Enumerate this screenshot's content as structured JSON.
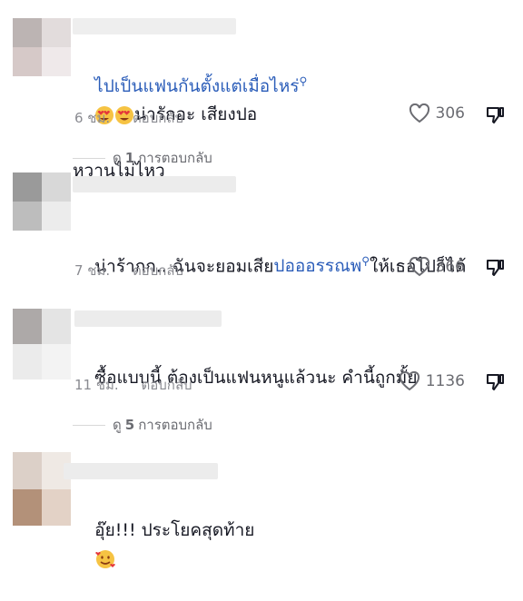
{
  "comments": [
    {
      "text_link": "ไปเป็นแฟนกันตั้งแต่เมื่อไหร่",
      "text_after": "น่ารักอะ เสียงปอ",
      "text_line2": "หวานไม่ไหว",
      "time": "6 ชม.",
      "reply_label": "ตอบกลับ",
      "likes": "306",
      "view_replies_prefix": "ดู",
      "view_replies_count": "1",
      "view_replies_suffix": "การตอบกลับ"
    },
    {
      "text_before": "น่าร้ากก.. ฉันจะยอมเสีย",
      "text_link": "ปอออรรณพ",
      "text_after": "ให้เธอไปก็ได้",
      "time": "7 ชม.",
      "reply_label": "ตอบกลับ",
      "likes": "366"
    },
    {
      "text": "ซื้อแบบนี้ ต้องเป็นแฟนหนูแล้วนะ คำนี้ถูกมั้ย",
      "time": "11 ชม.",
      "reply_label": "ตอบกลับ",
      "likes": "1136",
      "view_replies_prefix": "ดู",
      "view_replies_count": "5",
      "view_replies_suffix": "การตอบกลับ"
    },
    {
      "text": "อุ๊ย!!! ประโยคสุดท้าย"
    }
  ],
  "icons": {
    "like": "heart-outline-icon",
    "dislike": "thumbs-down-icon",
    "search_hint": "search-icon",
    "emoji_heart_eyes": "heart-eyes-emoji",
    "emoji_hearts": "smiling-face-with-hearts-emoji"
  },
  "colors": {
    "link": "#2b5db9",
    "meta": "#8a8b91",
    "text": "#161823"
  }
}
